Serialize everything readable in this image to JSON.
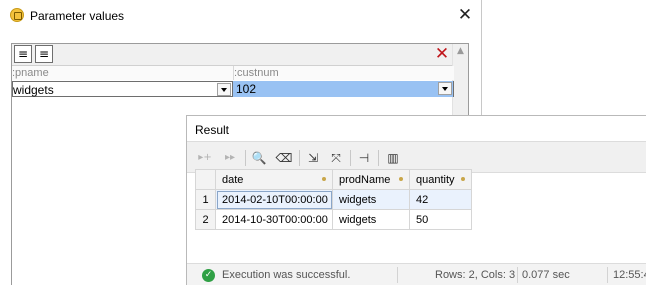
{
  "dialog": {
    "title": "Parameter values",
    "close_glyph": "✕",
    "toolbar": {
      "icons": [
        "insert-row-icon",
        "append-row-icon"
      ],
      "delete_glyph": "✕"
    },
    "columns": [
      ":pname",
      ":custnum"
    ],
    "row": {
      "pname": "widgets",
      "custnum": "102"
    }
  },
  "result": {
    "title": "Result",
    "toolbar_icons": [
      "previous-icon",
      "next-icon",
      "find-icon",
      "clear-icon",
      "export-icon",
      "maximize-icon",
      "pin-icon",
      "chart-icon"
    ],
    "columns": [
      "date",
      "prodName",
      "quantity"
    ],
    "rows": [
      {
        "num": "1",
        "date": "2014-02-10T00:00:00",
        "prodName": "widgets",
        "quantity": "42"
      },
      {
        "num": "2",
        "date": "2014-10-30T00:00:00",
        "prodName": "widgets",
        "quantity": "50"
      }
    ],
    "status": {
      "message": "Execution was successful.",
      "rows_cols": "Rows: 2, Cols: 3",
      "duration": "0.077 sec",
      "time": "12:55:4"
    }
  },
  "colors": {
    "selection": "#99c2f3",
    "success": "#2fa045",
    "delete": "#c0151b"
  }
}
